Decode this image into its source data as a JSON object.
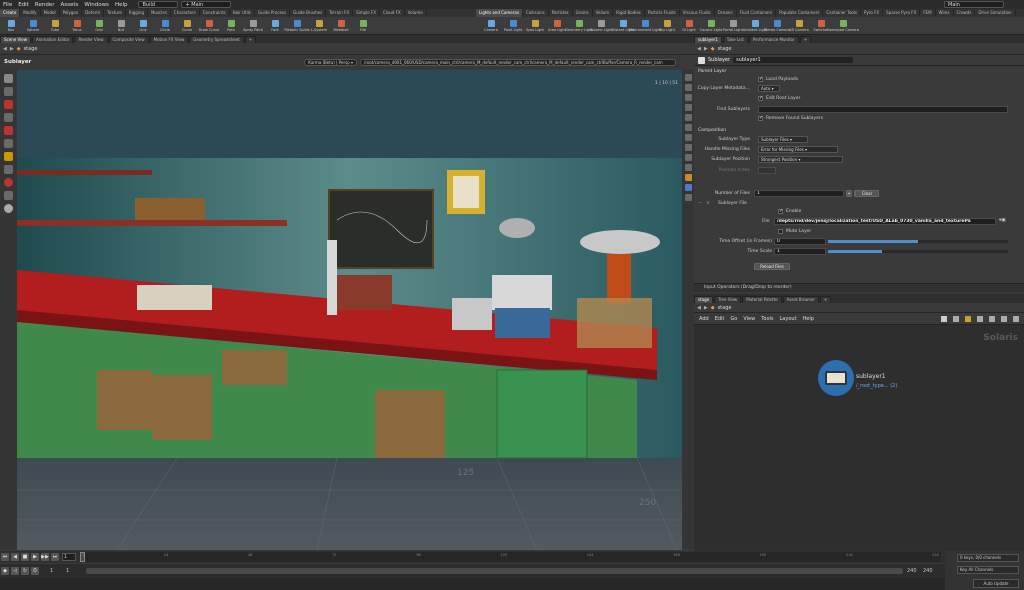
{
  "menubar": {
    "items": [
      "File",
      "Edit",
      "Render",
      "Assets",
      "Windows",
      "Help"
    ],
    "desktop": "Build",
    "context": "Main",
    "user": "Main"
  },
  "shelf_tabs": [
    "Create",
    "Modify",
    "Model",
    "Polygon",
    "Deform",
    "Texture",
    "Rigging",
    "Muscles",
    "Characters",
    "Constraints",
    "Hair Utils",
    "Guide Process",
    "Guide Brushes",
    "Terrain FX",
    "Simple FX",
    "Cloud FX",
    "Volume",
    "Lights and Cameras",
    "Collisions",
    "Particles",
    "Grains",
    "Vellum",
    "Rigid Bodies",
    "Particle Fluids",
    "Viscous Fluids",
    "Oceans",
    "Fluid Containers",
    "Populate Containers",
    "Container Tools",
    "Pyro FX",
    "Sparse Pyro FX",
    "FEM",
    "Wires",
    "Crowds",
    "Drive Simulation"
  ],
  "shelf_tools_left": [
    "Box",
    "Sphere",
    "Tube",
    "Torus",
    "Grid",
    "Null",
    "Line",
    "Circle",
    "Curve",
    "Draw Curve",
    "Path",
    "Spray Paint",
    "Font",
    "Platonic Solids",
    "L-System",
    "Metaball",
    "File"
  ],
  "shelf_tools_right": [
    "Camera",
    "Point Light",
    "Spot Light",
    "Area Light",
    "Geometry Light",
    "Volume Light",
    "Distant Light",
    "Environment Light",
    "Sky Light",
    "GI Light",
    "Caustic Light",
    "Portal Light",
    "Ambient Light",
    "Stereo Camera",
    "VR Camera",
    "Switcher",
    "Gamepad Camera"
  ],
  "left_pane_tabs": [
    "Scene View",
    "Animation Editor",
    "Render View",
    "Composite View",
    "Motion FX View",
    "Geometry Spreadsheet"
  ],
  "left_path": "stage",
  "viewport": {
    "node_label": "Sublayer",
    "renderer": "Karma (Beta)",
    "camera_mode": "Persp",
    "camera_path": "/root/camera_d001_060/USD/camera_main_ctrl/camera_M_default_render_cam_ctrl/camera_M_default_render_cam_ctrlBuffer/Camera_R_render_cam",
    "frame_info": "1 | 10 | 51",
    "grid_labels": [
      "125",
      "250"
    ]
  },
  "right_pane_tabs": [
    "sublayer1",
    "Take List",
    "Performance Monitor"
  ],
  "right_path": "stage",
  "params": {
    "node_type": "Sublayer",
    "node_name": "sublayer1",
    "parent_layer_heading": "Parent Layer",
    "load_payloads": "Load Payloads",
    "copy_layer_metadata_label": "Copy Layer Metadata...",
    "copy_layer_metadata_value": "Auto",
    "edit_root_layer": "Edit Root Layer",
    "find_sublayers_label": "Find Sublayers",
    "remove_found": "Remove Found Sublayers",
    "composition_heading": "Composition",
    "sublayer_type_label": "Sublayer Type",
    "sublayer_type_value": "Sublayer Files",
    "handle_missing_label": "Handle Missing Files",
    "handle_missing_value": "Error for Missing Files",
    "sublayer_position_label": "Sublayer Position",
    "sublayer_position_value": "Strongest Position",
    "position_index_label": "Position Index",
    "num_files_label": "Number of Files",
    "num_files_value": "1",
    "clear_button": "Clear",
    "sublayer_file_heading": "Sublayer File",
    "enable_label": "Enable",
    "file_label": "File",
    "file_value": "/depts/rnd/dev/jensj/localization_test/USD_ALab_0730_vanilla_and_texturePa",
    "mute_layer": "Mute Layer",
    "time_offset_label": "Time Offset (in Frames)",
    "time_offset_value": "0",
    "time_offset_fraction": 0.5,
    "time_scale_label": "Time Scale",
    "time_scale_value": "1",
    "time_scale_fraction": 0.3,
    "reload_button": "Reload Files"
  },
  "input_operators": "Input Operators (Drag/Drop to reorder)",
  "network_tabs": [
    "stage",
    "Tree View",
    "Material Palette",
    "Asset Browser"
  ],
  "network_path": "stage",
  "network_menu": [
    "Add",
    "Edit",
    "Go",
    "View",
    "Tools",
    "Layout",
    "Help"
  ],
  "network": {
    "context_label": "Solaris",
    "node_name": "sublayer1",
    "node_sub": "/_root_type... (2)"
  },
  "timeline": {
    "current_frame": "1",
    "ticks": [
      "1",
      "24",
      "48",
      "72",
      "96",
      "120",
      "144",
      "168",
      "192",
      "216",
      "240"
    ],
    "start": "1",
    "start2": "1",
    "end": "240",
    "end2": "240"
  },
  "bottom_right": {
    "keys": "0 keys, 0/0 channels",
    "key_all": "Key All Channels",
    "auto_update": "Auto Update"
  }
}
